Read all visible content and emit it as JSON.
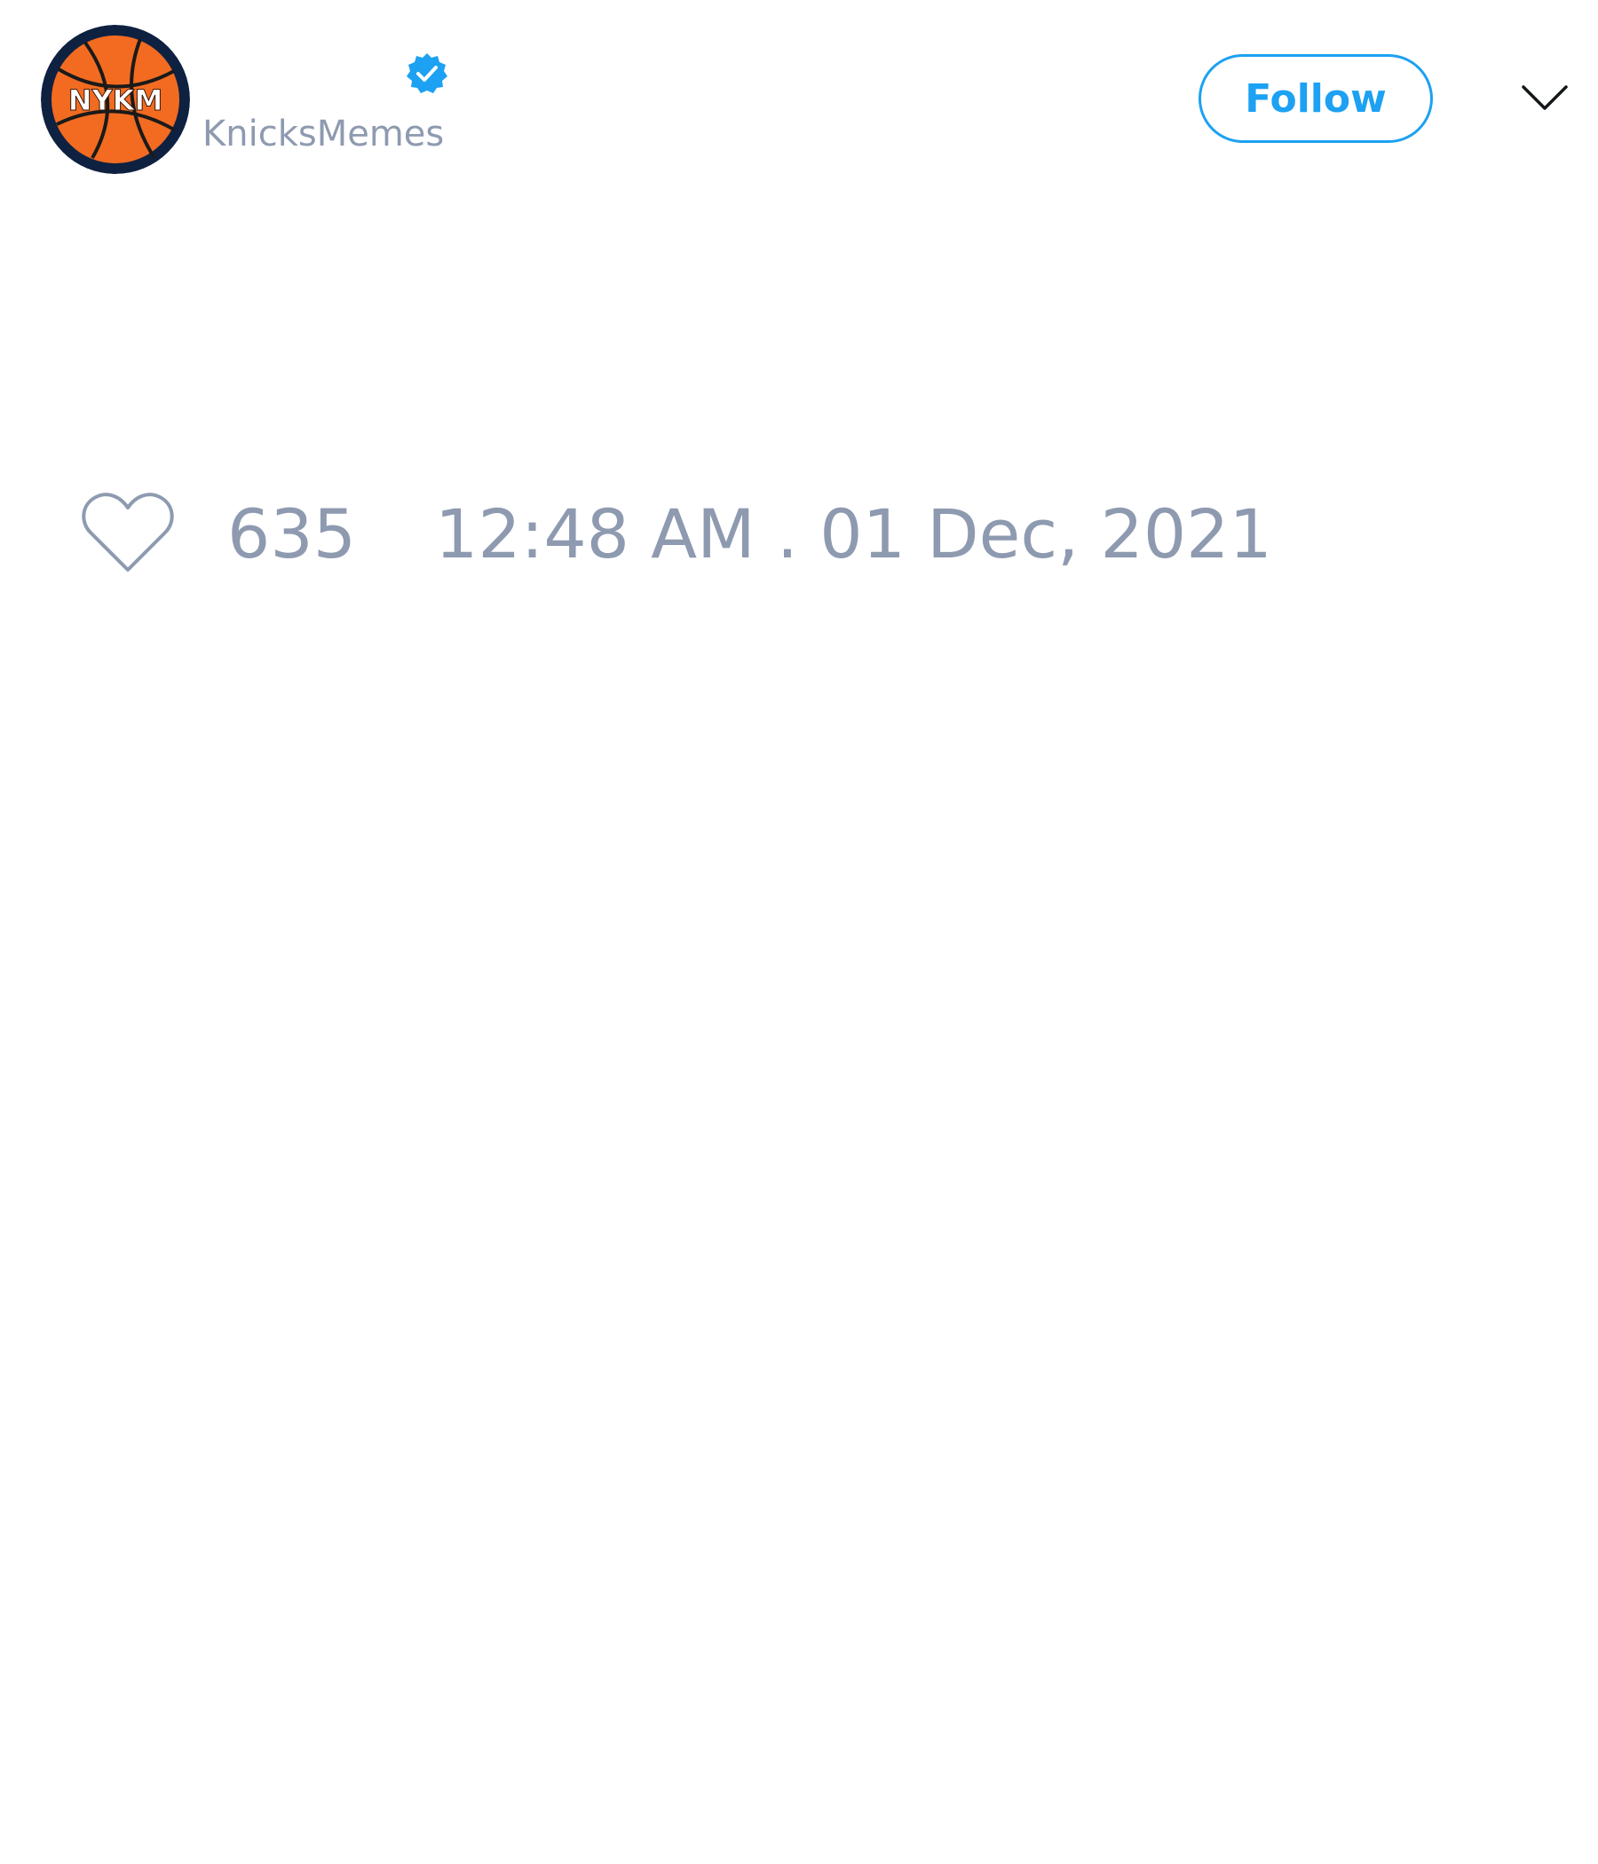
{
  "tweet": {
    "author": {
      "display_name": "",
      "handle": "KnicksMemes",
      "avatar_text": "NYKM",
      "verified": true
    },
    "follow_label": "Follow",
    "likes": "635",
    "timestamp": "12:48 AM . 01 Dec, 2021"
  },
  "icons": {
    "verified": "verified-badge-icon",
    "menu": "chevron-down-icon",
    "like": "heart-icon"
  },
  "colors": {
    "accent": "#1da1f2",
    "muted_text": "#8e9ab0",
    "avatar_ball": "#f26b21",
    "avatar_ring": "#0f2141",
    "background": "#ffffff"
  }
}
